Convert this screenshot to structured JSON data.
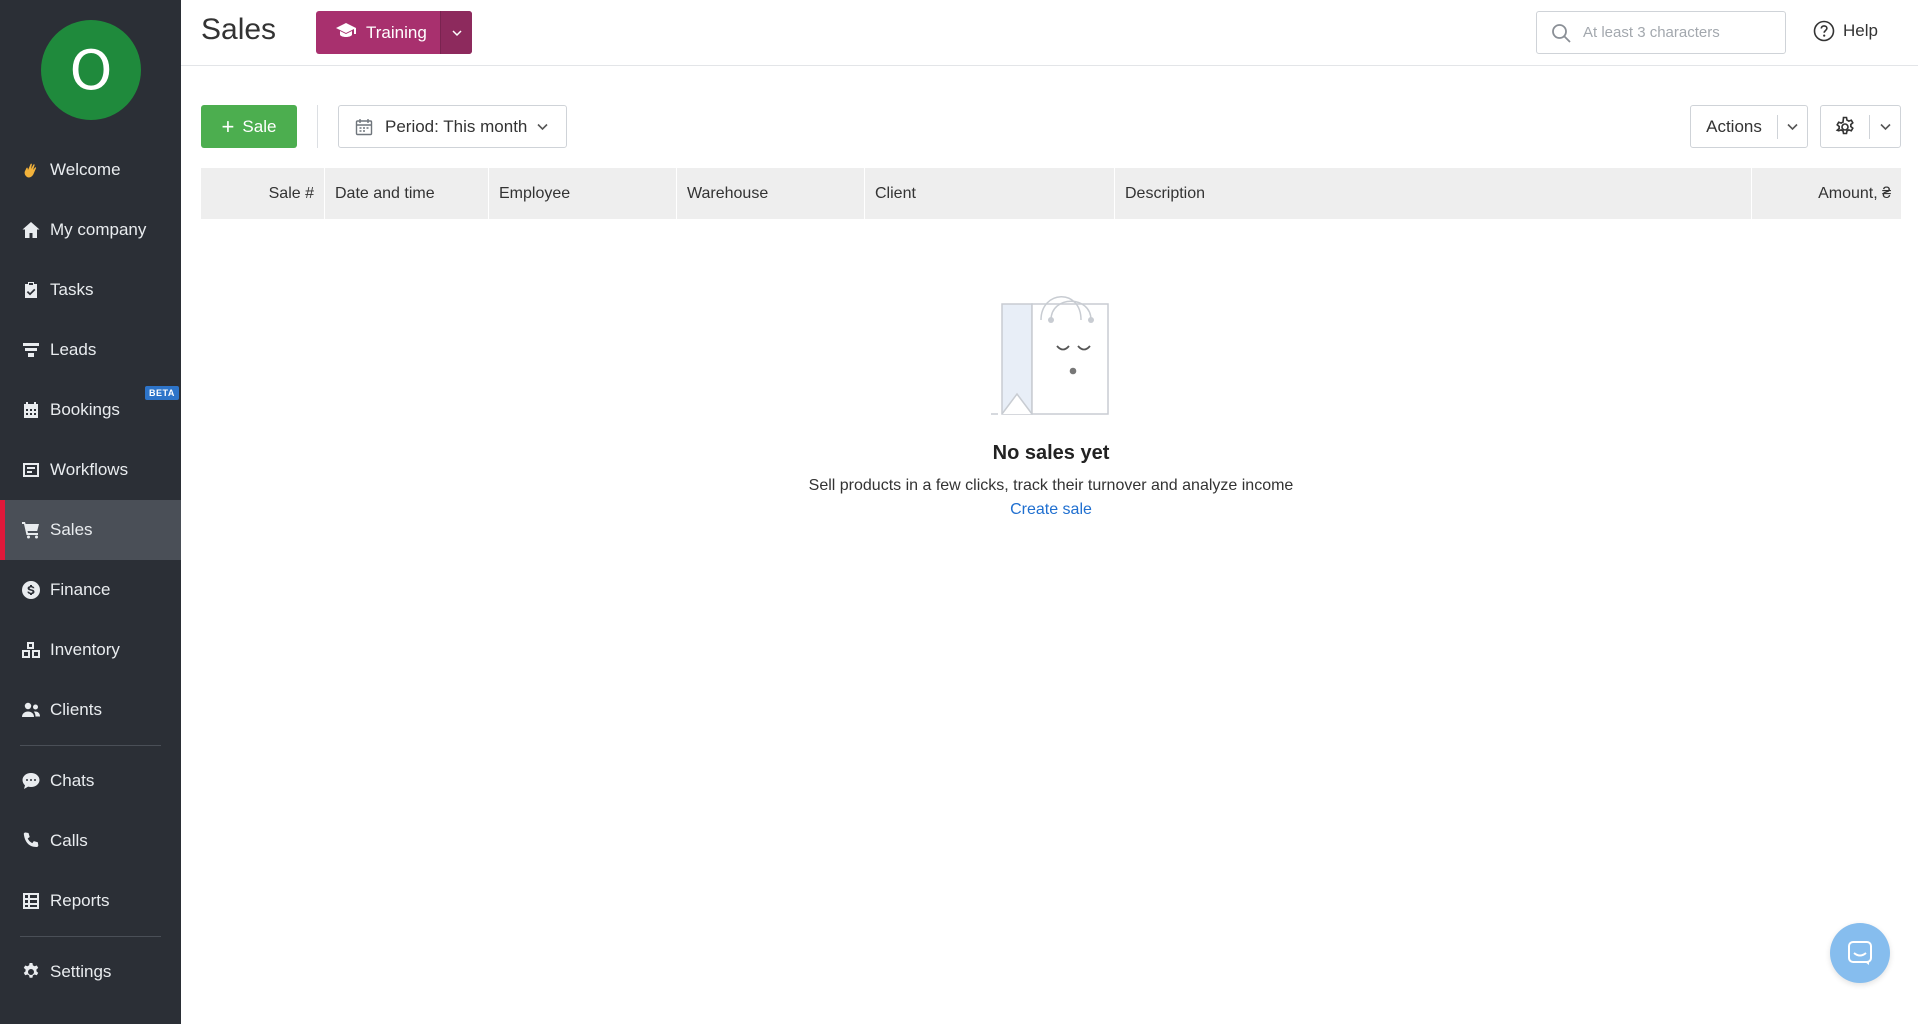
{
  "user": {
    "avatar_letter": "O",
    "avatar_color": "#1f8a3c"
  },
  "sidebar": {
    "items": [
      {
        "label": "Welcome",
        "icon": "waving-hand-icon"
      },
      {
        "label": "My company",
        "icon": "home-icon"
      },
      {
        "label": "Tasks",
        "icon": "clipboard-check-icon"
      },
      {
        "label": "Leads",
        "icon": "funnel-icon"
      },
      {
        "label": "Bookings",
        "icon": "calendar-grid-icon",
        "badge": "BETA"
      },
      {
        "label": "Workflows",
        "icon": "workflow-board-icon"
      },
      {
        "label": "Sales",
        "icon": "cart-icon",
        "active": true
      },
      {
        "label": "Finance",
        "icon": "dollar-coin-icon"
      },
      {
        "label": "Inventory",
        "icon": "boxes-icon"
      },
      {
        "label": "Clients",
        "icon": "users-icon"
      },
      {
        "label": "Chats",
        "icon": "chat-bubble-icon"
      },
      {
        "label": "Calls",
        "icon": "phone-icon"
      },
      {
        "label": "Reports",
        "icon": "table-report-icon"
      },
      {
        "label": "Settings",
        "icon": "gear-icon"
      }
    ],
    "active_color": "#e0183a"
  },
  "header": {
    "title": "Sales",
    "training_label": "Training",
    "training_color": "#a8306e",
    "search_placeholder": "At least 3 characters",
    "help_label": "Help"
  },
  "toolbar": {
    "sale_label": "Sale",
    "sale_color": "#4cae4f",
    "period_label": "Period: This month",
    "actions_label": "Actions"
  },
  "table": {
    "columns": [
      "Sale #",
      "Date and time",
      "Employee",
      "Warehouse",
      "Client",
      "Description",
      "Amount, ₴"
    ],
    "rows": []
  },
  "empty_state": {
    "title": "No sales yet",
    "subtitle": "Sell products in a few clicks, track their turnover and analyze income",
    "link": "Create sale"
  }
}
